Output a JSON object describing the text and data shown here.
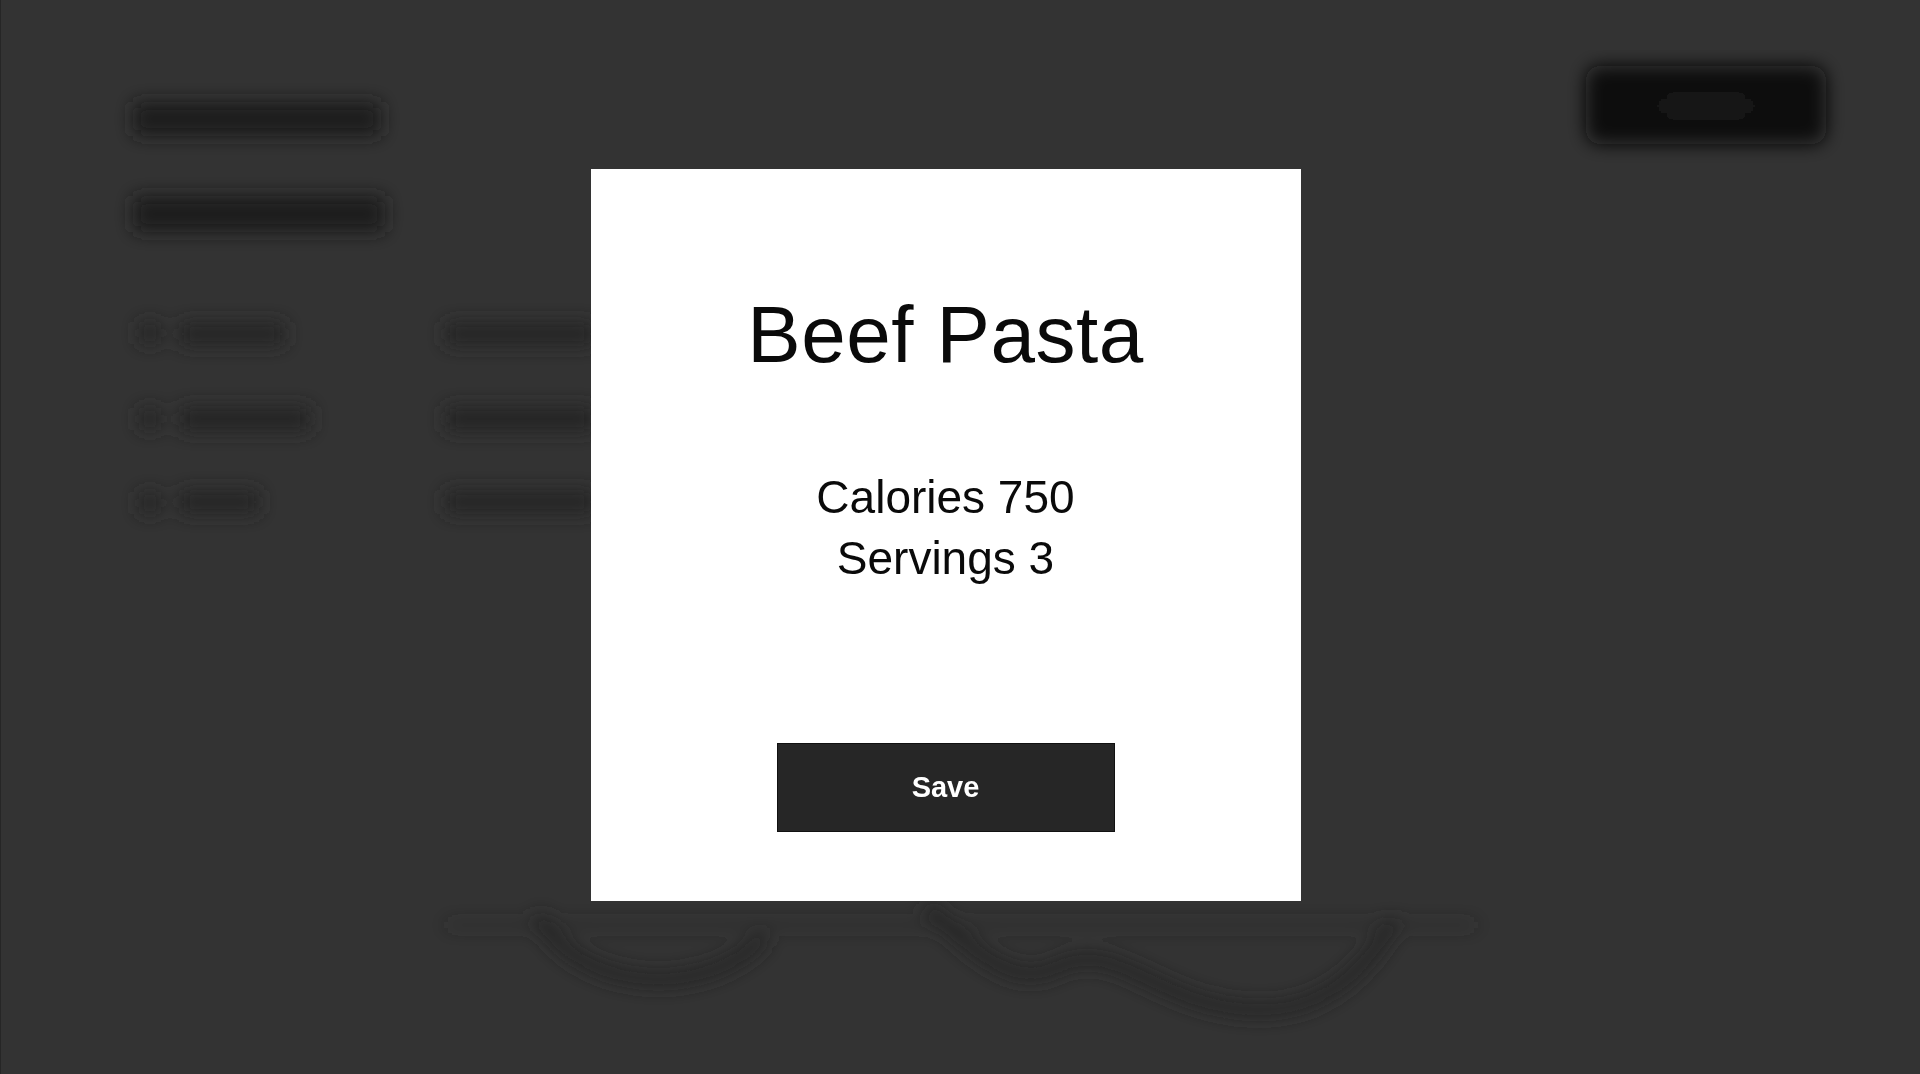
{
  "dialog": {
    "title": "Beef Pasta",
    "details": [
      "Calories 750",
      "Servings 3"
    ],
    "buttons": [
      "Save"
    ]
  }
}
